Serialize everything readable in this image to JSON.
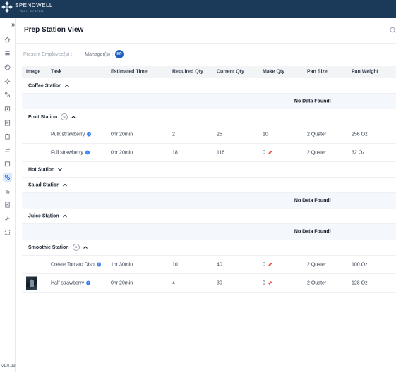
{
  "brand": {
    "name": "SPENDWELL",
    "subtitle": "TECH SYSTEM"
  },
  "sidebar": {
    "expand_glyph": "»",
    "items": [
      {
        "icon": "home-icon"
      },
      {
        "icon": "menu-icon"
      },
      {
        "icon": "palette-icon"
      },
      {
        "icon": "settings-gear-icon"
      },
      {
        "icon": "nodes-icon"
      },
      {
        "icon": "inbox-icon"
      },
      {
        "icon": "list-icon"
      },
      {
        "icon": "clipboard-icon"
      },
      {
        "icon": "swap-icon"
      },
      {
        "icon": "calendar-icon"
      },
      {
        "icon": "prep-station-icon",
        "active": true
      },
      {
        "icon": "hand-icon"
      },
      {
        "icon": "report-icon"
      },
      {
        "icon": "tools-icon"
      },
      {
        "icon": "dashboard-icon"
      }
    ],
    "version": "v1.0.23"
  },
  "page": {
    "title": "Prep Station View"
  },
  "employees": {
    "present_label": "Present Employee(s) :",
    "manager_label": "Manager(s) :",
    "manager_initials": "KP"
  },
  "table": {
    "headers": [
      "Image",
      "Task",
      "Estimated Time",
      "Required Qty",
      "Current Qty",
      "Make Qty",
      "Pan Size",
      "Pan Weight"
    ],
    "no_data": "No Data Found!",
    "stations": {
      "coffee": "Coffee Station",
      "fruit": "Fruit Station",
      "hot": "Hot Station",
      "salad": "Salad Station",
      "juice": "Juice Station",
      "smoothie": "Smoothie Station"
    },
    "fruit_rows": [
      {
        "task": "Pulk strawberry",
        "time": "0hr 20min",
        "req": "2",
        "cur": "25",
        "make": "10",
        "pan": "2 Quater",
        "wt": "256 Oz"
      },
      {
        "task": "Full strawberry",
        "time": "0hr 20min",
        "req": "18",
        "cur": "116",
        "make": "0",
        "pan": "2 Quater",
        "wt": "32 Oz"
      }
    ],
    "smoothie_rows": [
      {
        "task": "Create Tomato Dish",
        "time": "1hr 30min",
        "req": "10",
        "cur": "40",
        "make": "0",
        "pan": "2 Quater",
        "wt": "100 Oz"
      },
      {
        "task": "Half strawberry",
        "time": "0hr 20min",
        "req": "4",
        "cur": "30",
        "make": "0",
        "pan": "2 Quater",
        "wt": "128 Oz"
      }
    ]
  },
  "colors": {
    "topbar": "#1b3a5a",
    "accent": "#1f5fbf",
    "info": "#3b82f6"
  }
}
